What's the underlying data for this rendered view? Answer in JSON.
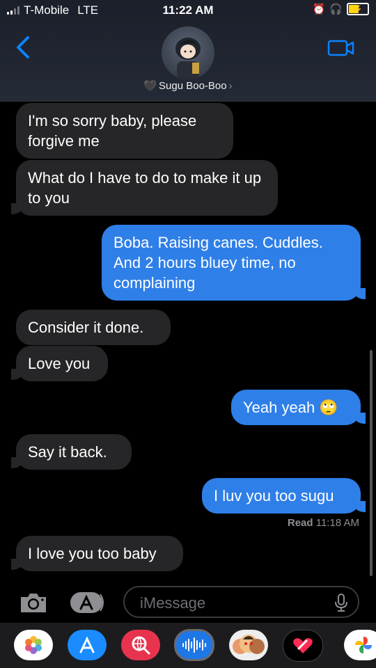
{
  "status_bar": {
    "carrier": "T-Mobile",
    "network": "LTE",
    "time": "11:22 AM"
  },
  "header": {
    "contact_name": "Sugu Boo-Boo",
    "contact_emoji": "🖤"
  },
  "messages": [
    {
      "side": "in",
      "text": "I'm so sorry baby, please forgive me"
    },
    {
      "side": "in",
      "text": "What do I have to do to make it up to you"
    },
    {
      "side": "out",
      "text": "Boba. Raising canes. Cuddles. And 2 hours bluey time, no complaining"
    },
    {
      "side": "in",
      "text": "Consider it done."
    },
    {
      "side": "in",
      "text": "Love you"
    },
    {
      "side": "out",
      "text": "Yeah yeah 🙄"
    },
    {
      "side": "in",
      "text": "Say it back."
    },
    {
      "side": "out",
      "text": "I luv you too sugu"
    },
    {
      "side": "in",
      "text": "I love you too baby"
    }
  ],
  "read_receipt": {
    "label": "Read",
    "time": "11:18 AM"
  },
  "input": {
    "placeholder": "iMessage"
  },
  "app_tray": [
    "photos-icon",
    "app-store-icon",
    "web-search-icon",
    "audio-message-icon",
    "memoji-icon",
    "digital-touch-icon",
    "google-photos-icon"
  ],
  "colors": {
    "outgoing": "#2f7fe8",
    "incoming": "#262628",
    "accent": "#0a84ff"
  }
}
